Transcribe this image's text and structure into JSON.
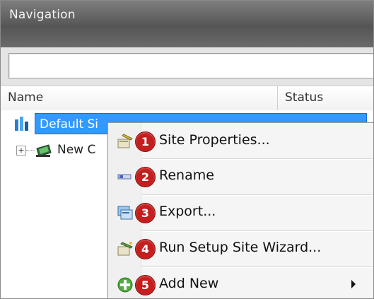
{
  "navigation": {
    "title": "Navigation",
    "search": {
      "value": ""
    }
  },
  "columns": {
    "name": "Name",
    "status": "Status"
  },
  "tree": {
    "items": [
      {
        "label": "Default Si",
        "selected": true,
        "icon": "site-icon"
      },
      {
        "label": "New C",
        "selected": false,
        "icon": "globe-icon",
        "expander": "+"
      }
    ]
  },
  "context_menu": {
    "items": [
      {
        "badge": "1",
        "label": "Site Properties...",
        "icon": "properties-icon"
      },
      {
        "badge": "2",
        "label": "Rename",
        "icon": "rename-icon"
      },
      {
        "badge": "3",
        "label": "Export...",
        "icon": "export-icon"
      },
      {
        "badge": "4",
        "label": "Run Setup Site Wizard...",
        "icon": "wizard-icon"
      },
      {
        "badge": "5",
        "label": "Add New",
        "icon": "add-icon",
        "has_submenu": true
      }
    ]
  },
  "colors": {
    "selection": "#3399ff",
    "badge": "#c41e1e",
    "header": "#5d5d5d"
  }
}
